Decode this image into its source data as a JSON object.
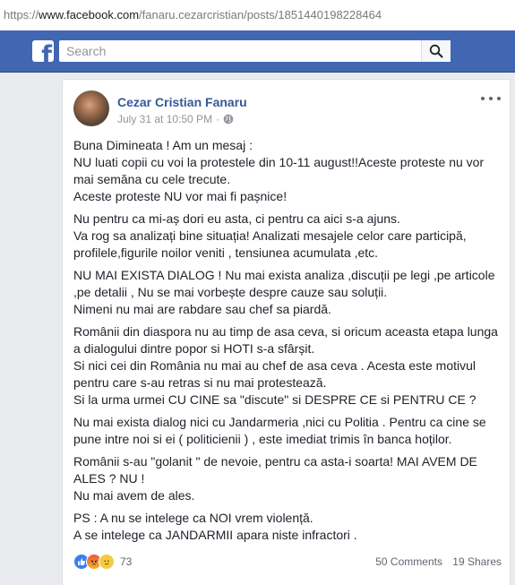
{
  "browser": {
    "url_scheme": "https://",
    "url_host": "www.facebook.com",
    "url_path": "/fanaru.cezarcristian/posts/1851440198228464"
  },
  "header": {
    "logo_icon": "facebook-f-icon",
    "search_placeholder": "Search",
    "search_icon": "magnifier-icon",
    "brand_color": "#4267b2"
  },
  "post": {
    "author": "Cezar Cristian Fanaru",
    "timestamp": "July 31 at 10:50 PM",
    "separator": "·",
    "privacy_icon": "globe-icon",
    "options_icon": "more-horizontal-icon",
    "paragraphs": [
      [
        "Buna Dimineata ! Am un mesaj :",
        "NU luati copii cu voi la protestele din 10-11 august!!Aceste proteste nu vor",
        "mai semăna cu cele trecute.",
        "Aceste proteste NU vor mai fi pașnice!"
      ],
      [
        "Nu pentru ca mi-aș dori eu asta, ci pentru ca aici s-a ajuns.",
        "Va rog sa analizați bine situația! Analizati mesajele celor care participă,",
        "profilele,figurile noilor veniti , tensiunea acumulata ,etc."
      ],
      [
        "NU MAI EXISTA DIALOG ! Nu mai exista analiza ,discuții pe legi ,pe articole",
        ",pe detalii , Nu se mai vorbește despre cauze sau soluții.",
        "Nimeni nu mai are rabdare sau chef sa piardă."
      ],
      [
        "Românii din diaspora nu au timp de asa ceva, si oricum aceasta etapa lunga",
        "a dialogului dintre popor si HOTI s-a sfârșit.",
        "Si nici cei din România nu mai au chef de asa ceva . Acesta este motivul",
        "pentru care s-au retras si nu mai protestează.",
        "Si la urma urmei CU CINE sa \"discute\" si DESPRE CE si PENTRU CE ?"
      ],
      [
        "Nu mai exista dialog nici cu Jandarmeria ,nici cu Politia . Pentru ca cine se",
        "pune intre noi si ei ( politicienii ) , este imediat trimis în banca hoților."
      ],
      [
        "Românii s-au \"golanit \" de nevoie, pentru ca asta-i soarta! MAI AVEM DE",
        "ALES ? NU !",
        "Nu mai avem de ales."
      ],
      [
        "PS : A nu se intelege ca NOI vrem violență.",
        "A se intelege ca JANDARMII apara niste infractori ."
      ]
    ],
    "reactions": {
      "icons": [
        "like-icon",
        "angry-icon",
        "sad-icon"
      ],
      "count": "73"
    },
    "comments": "50 Comments",
    "shares": "19 Shares"
  }
}
